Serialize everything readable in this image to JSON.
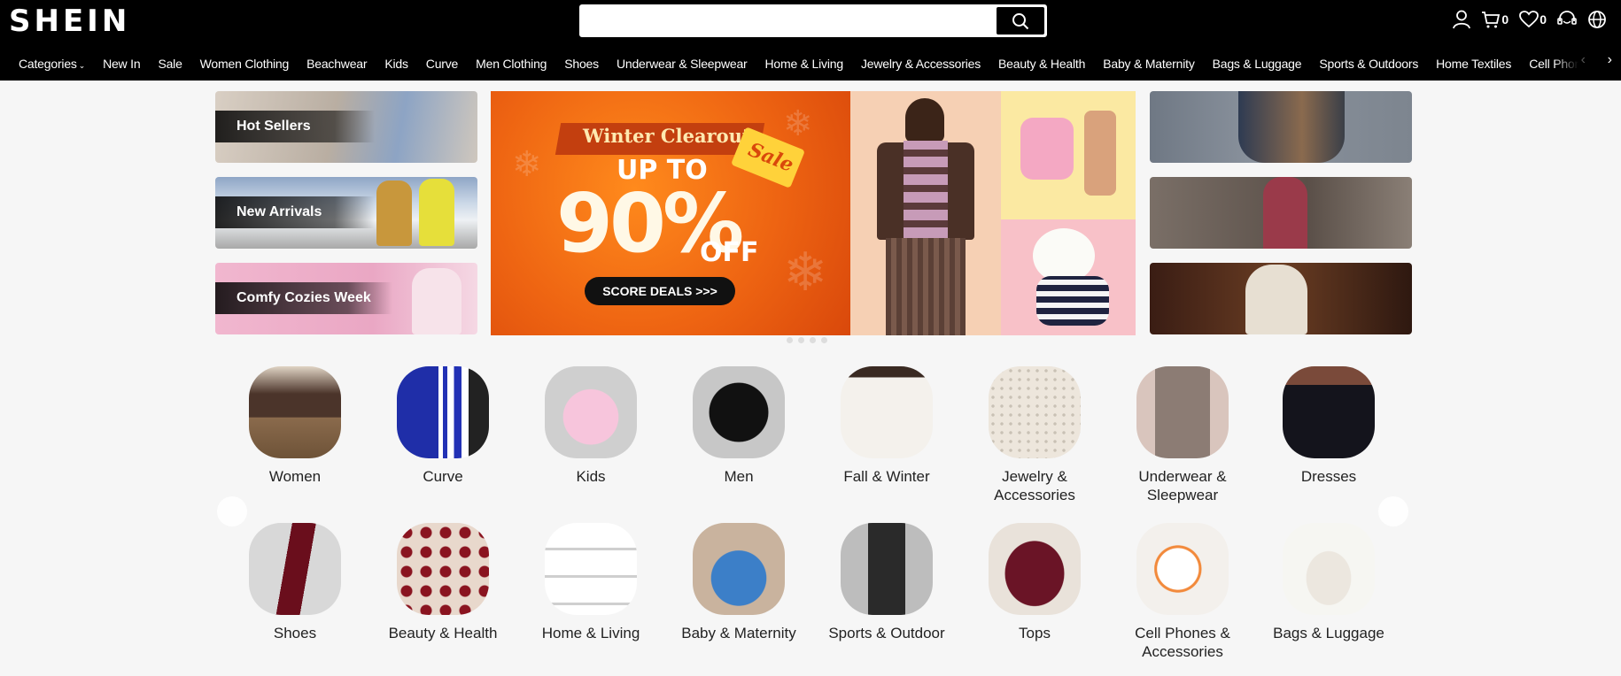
{
  "header": {
    "logo": "SHEIN",
    "search": {
      "placeholder": "",
      "value": ""
    },
    "cart_count": "0",
    "wishlist_count": "0"
  },
  "nav": {
    "items": [
      "Categories",
      "New In",
      "Sale",
      "Women Clothing",
      "Beachwear",
      "Kids",
      "Curve",
      "Men Clothing",
      "Shoes",
      "Underwear & Sleepwear",
      "Home & Living",
      "Jewelry & Accessories",
      "Beauty & Health",
      "Baby & Maternity",
      "Bags & Luggage",
      "Sports & Outdoors",
      "Home Textiles",
      "Cell Phon"
    ]
  },
  "hero": {
    "left_tiles": [
      "Hot Sellers",
      "New Arrivals",
      "Comfy Cozies Week"
    ],
    "banner": {
      "ribbon": "Winter Clearout",
      "tag": "Sale",
      "up_to": "UP TO",
      "percent": "90%",
      "off": "OFF",
      "cta": "SCORE DEALS >>>"
    }
  },
  "categories": {
    "row1": [
      "Women",
      "Curve",
      "Kids",
      "Men",
      "Fall & Winter",
      "Jewelry & Accessories",
      "Underwear & Sleepwear",
      "Dresses"
    ],
    "row2": [
      "Shoes",
      "Beauty & Health",
      "Home & Living",
      "Baby & Maternity",
      "Sports & Outdoor",
      "Tops",
      "Cell Phones & Accessories",
      "Bags & Luggage"
    ]
  },
  "colors": {
    "topbar": "#000000",
    "banner_orange": "#ee6412",
    "page_bg": "#f6f6f6"
  }
}
